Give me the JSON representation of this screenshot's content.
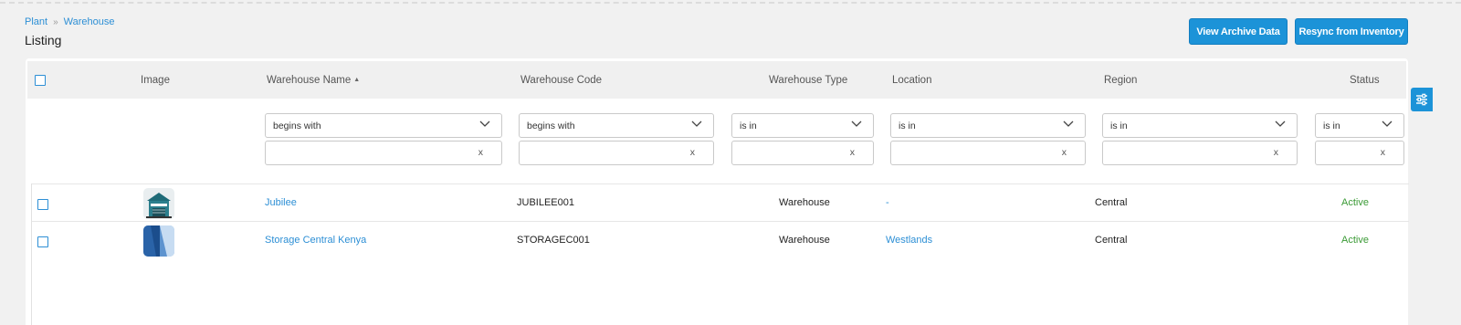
{
  "breadcrumb": {
    "items": [
      "Plant",
      "Warehouse"
    ],
    "separator": "»"
  },
  "page_title": "Listing",
  "buttons": {
    "archive": "View Archive Data",
    "resync": "Resync from Inventory"
  },
  "table": {
    "columns": {
      "image": "Image",
      "name": "Warehouse Name",
      "code": "Warehouse Code",
      "type": "Warehouse Type",
      "location": "Location",
      "region": "Region",
      "status": "Status"
    },
    "filters": {
      "name": {
        "operator": "begins with",
        "value": "",
        "clear": "x"
      },
      "code": {
        "operator": "begins with",
        "value": "",
        "clear": "x"
      },
      "type": {
        "operator": "is in",
        "value": "",
        "clear": "x"
      },
      "location": {
        "operator": "is in",
        "value": "",
        "clear": "x"
      },
      "region": {
        "operator": "is in",
        "value": "",
        "clear": "x"
      },
      "status": {
        "operator": "is in",
        "value": "",
        "clear": "x"
      }
    },
    "rows": [
      {
        "name": "Jubilee",
        "code": "JUBILEE001",
        "type": "Warehouse",
        "location": "-",
        "region": "Central",
        "status": "Active",
        "image_icon": "warehouse-building-icon"
      },
      {
        "name": "Storage Central Kenya",
        "code": "STORAGEC001",
        "type": "Warehouse",
        "location": "Westlands",
        "region": "Central",
        "status": "Active",
        "image_icon": "storage-logo-icon"
      }
    ]
  },
  "colors": {
    "accent": "#1c93d8",
    "link": "#2d8fd5",
    "status_active": "#3a9a35"
  }
}
